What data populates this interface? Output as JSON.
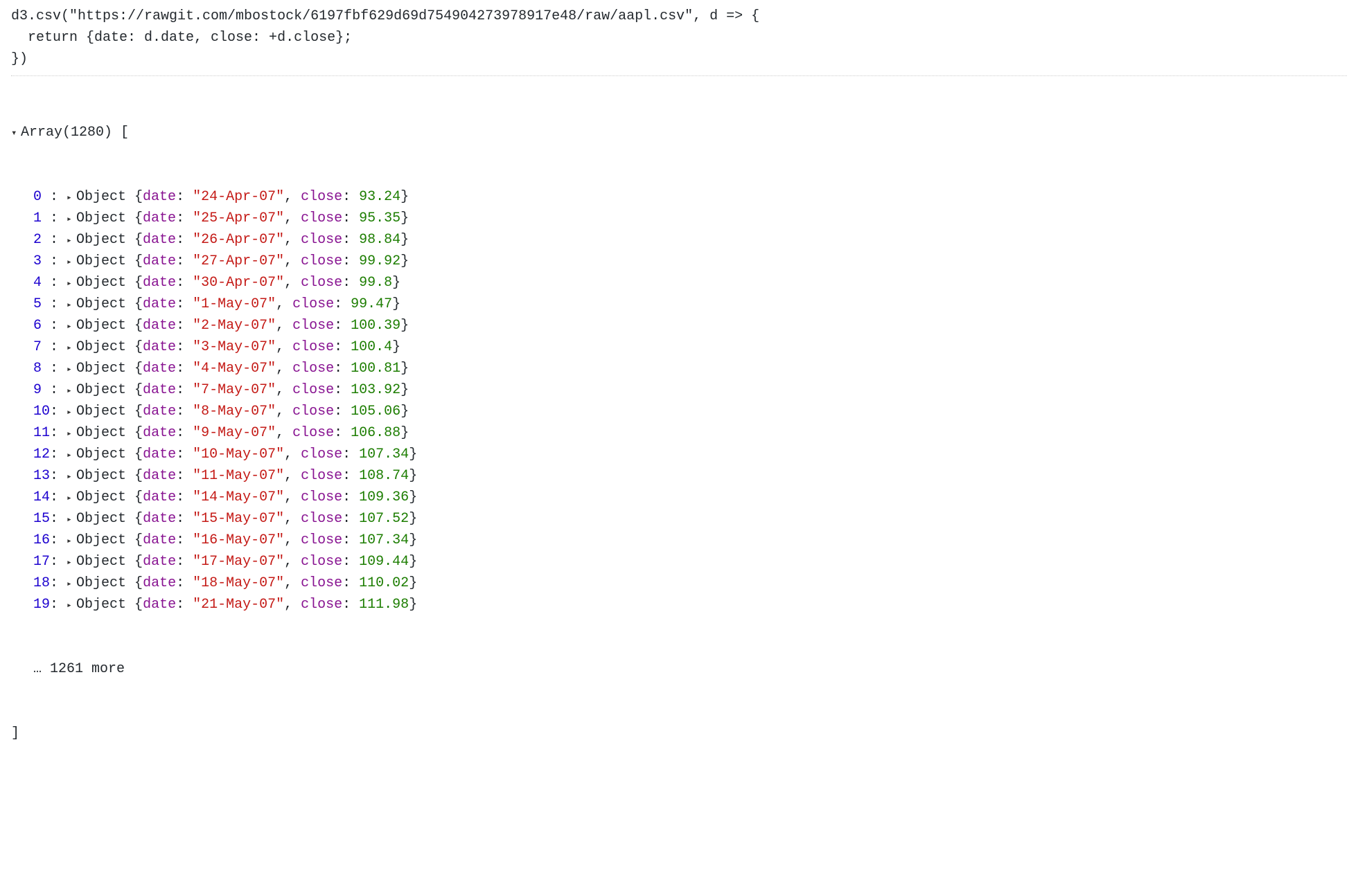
{
  "code": {
    "line1": "d3.csv(\"https://rawgit.com/mbostock/6197fbf629d69d754904273978917e48/raw/aapl.csv\", d => {",
    "line2": "  return {date: d.date, close: +d.close};",
    "line3": "})"
  },
  "output": {
    "array_label": "Array(1280) [",
    "close_bracket": "]",
    "more_text": "… 1261 more",
    "key_date": "date",
    "key_close": "close",
    "object_label": "Object",
    "rows": [
      {
        "idx": "0",
        "date": "24-Apr-07",
        "close": "93.24"
      },
      {
        "idx": "1",
        "date": "25-Apr-07",
        "close": "95.35"
      },
      {
        "idx": "2",
        "date": "26-Apr-07",
        "close": "98.84"
      },
      {
        "idx": "3",
        "date": "27-Apr-07",
        "close": "99.92"
      },
      {
        "idx": "4",
        "date": "30-Apr-07",
        "close": "99.8"
      },
      {
        "idx": "5",
        "date": "1-May-07",
        "close": "99.47"
      },
      {
        "idx": "6",
        "date": "2-May-07",
        "close": "100.39"
      },
      {
        "idx": "7",
        "date": "3-May-07",
        "close": "100.4"
      },
      {
        "idx": "8",
        "date": "4-May-07",
        "close": "100.81"
      },
      {
        "idx": "9",
        "date": "7-May-07",
        "close": "103.92"
      },
      {
        "idx": "10",
        "date": "8-May-07",
        "close": "105.06"
      },
      {
        "idx": "11",
        "date": "9-May-07",
        "close": "106.88"
      },
      {
        "idx": "12",
        "date": "10-May-07",
        "close": "107.34"
      },
      {
        "idx": "13",
        "date": "11-May-07",
        "close": "108.74"
      },
      {
        "idx": "14",
        "date": "14-May-07",
        "close": "109.36"
      },
      {
        "idx": "15",
        "date": "15-May-07",
        "close": "107.52"
      },
      {
        "idx": "16",
        "date": "16-May-07",
        "close": "107.34"
      },
      {
        "idx": "17",
        "date": "17-May-07",
        "close": "109.44"
      },
      {
        "idx": "18",
        "date": "18-May-07",
        "close": "110.02"
      },
      {
        "idx": "19",
        "date": "21-May-07",
        "close": "111.98"
      }
    ]
  }
}
